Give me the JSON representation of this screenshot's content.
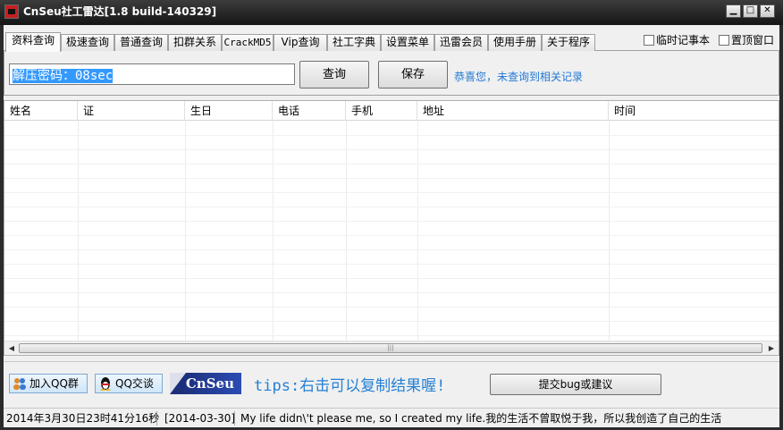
{
  "window": {
    "title": "CnSeu社工雷达[1.8 build-140329]",
    "minimize_glyph": "▁",
    "maximize_glyph": "□",
    "close_glyph": "✕"
  },
  "tabs": [
    {
      "label": "资料查询",
      "active": true
    },
    {
      "label": "极速查询"
    },
    {
      "label": "普通查询"
    },
    {
      "label": "扣群关系"
    },
    {
      "label": "CrackMD5"
    },
    {
      "label": "Vip查询"
    },
    {
      "label": "社工字典"
    },
    {
      "label": "设置菜单"
    },
    {
      "label": "迅雷会员"
    },
    {
      "label": "使用手册"
    },
    {
      "label": "关于程序"
    }
  ],
  "options": {
    "notepad_label": "临时记事本",
    "notepad_checked": false,
    "topmost_label": "置顶窗口",
    "topmost_checked": false
  },
  "search": {
    "value": "解压密码：08sec",
    "query_label": "查询",
    "save_label": "保存",
    "status_message": "恭喜您，未查询到相关记录"
  },
  "table": {
    "columns": [
      "姓名",
      "证",
      "生日",
      "电话",
      "手机",
      "地址",
      "时间"
    ],
    "rows": []
  },
  "bottom": {
    "join_qq_group": "加入QQ群",
    "qq_chat": "QQ交谈",
    "logo_text": "CnSeu",
    "tips": "tips:右击可以复制结果喔!",
    "submit_label": "提交bug或建议"
  },
  "statusbar": {
    "datetime": "2014年3月30日23时41分16秒",
    "date": "[2014-03-30]",
    "quote": "My life didn\\'t please me, so I created my life.我的生活不曾取悦于我，所以我创造了自己的生活"
  },
  "colors": {
    "link_blue": "#2178d4",
    "selection": "#3399ff",
    "logo_blue": "#2c4cb4"
  }
}
